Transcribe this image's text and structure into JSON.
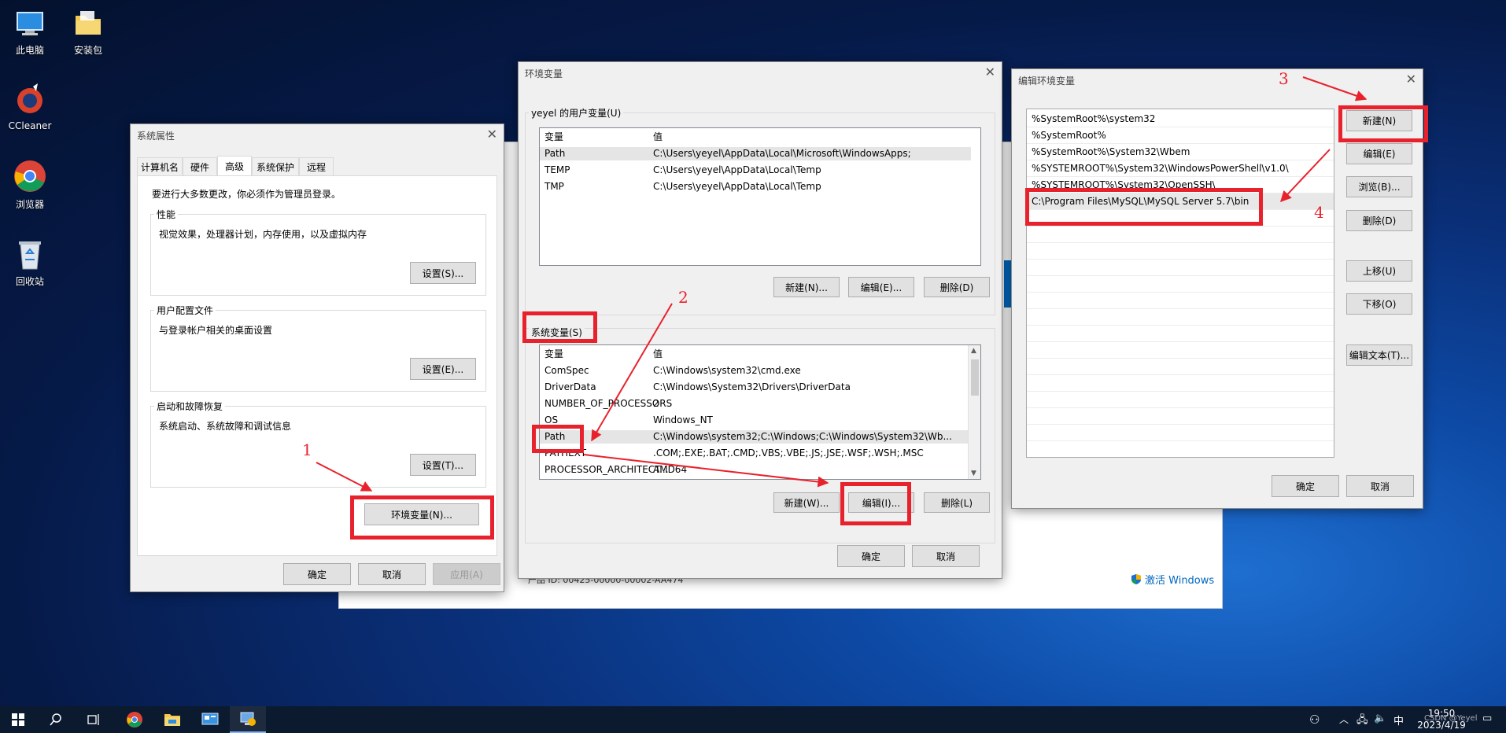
{
  "desktop": {
    "icons": [
      {
        "label": "此电脑"
      },
      {
        "label": "安装包"
      },
      {
        "label": "CCleaner"
      },
      {
        "label": "浏览器"
      },
      {
        "label": "回收站"
      }
    ],
    "activate_windows": "激活 Windows",
    "bg_product_id": "产品 ID: 00425-00000-00002-AA474"
  },
  "sysprops": {
    "title": "系统属性",
    "tabs": [
      "计算机名",
      "硬件",
      "高级",
      "系统保护",
      "远程"
    ],
    "admin_note": "要进行大多数更改，你必须作为管理员登录。",
    "groups": [
      {
        "label": "性能",
        "desc": "视觉效果，处理器计划，内存使用，以及虚拟内存",
        "button": "设置(S)..."
      },
      {
        "label": "用户配置文件",
        "desc": "与登录帐户相关的桌面设置",
        "button": "设置(E)..."
      },
      {
        "label": "启动和故障恢复",
        "desc": "系统启动、系统故障和调试信息",
        "button": "设置(T)..."
      }
    ],
    "env_button": "环境变量(N)...",
    "ok": "确定",
    "cancel": "取消",
    "apply": "应用(A)"
  },
  "envvars": {
    "title": "环境变量",
    "user_group_label": "yeyel 的用户变量(U)",
    "col_var": "变量",
    "col_val": "值",
    "user_vars": [
      {
        "name": "Path",
        "value": "C:\\Users\\yeyel\\AppData\\Local\\Microsoft\\WindowsApps;"
      },
      {
        "name": "TEMP",
        "value": "C:\\Users\\yeyel\\AppData\\Local\\Temp"
      },
      {
        "name": "TMP",
        "value": "C:\\Users\\yeyel\\AppData\\Local\\Temp"
      }
    ],
    "user_buttons": {
      "new": "新建(N)...",
      "edit": "编辑(E)...",
      "delete": "删除(D)"
    },
    "sys_group_label": "系统变量(S)",
    "sys_vars": [
      {
        "name": "ComSpec",
        "value": "C:\\Windows\\system32\\cmd.exe"
      },
      {
        "name": "DriverData",
        "value": "C:\\Windows\\System32\\Drivers\\DriverData"
      },
      {
        "name": "NUMBER_OF_PROCESSORS",
        "value": "2"
      },
      {
        "name": "OS",
        "value": "Windows_NT"
      },
      {
        "name": "Path",
        "value": "C:\\Windows\\system32;C:\\Windows;C:\\Windows\\System32\\Wb..."
      },
      {
        "name": "PATHEXT",
        "value": ".COM;.EXE;.BAT;.CMD;.VBS;.VBE;.JS;.JSE;.WSF;.WSH;.MSC"
      },
      {
        "name": "PROCESSOR_ARCHITECT...",
        "value": "AMD64"
      }
    ],
    "sys_buttons": {
      "new": "新建(W)...",
      "edit": "编辑(I)...",
      "delete": "删除(L)"
    },
    "ok": "确定",
    "cancel": "取消"
  },
  "editenv": {
    "title": "编辑环境变量",
    "entries": [
      "%SystemRoot%\\system32",
      "%SystemRoot%",
      "%SystemRoot%\\System32\\Wbem",
      "%SYSTEMROOT%\\System32\\WindowsPowerShell\\v1.0\\",
      "%SYSTEMROOT%\\System32\\OpenSSH\\",
      "C:\\Program Files\\MySQL\\MySQL Server 5.7\\bin"
    ],
    "buttons": {
      "new": "新建(N)",
      "edit": "编辑(E)",
      "browse": "浏览(B)...",
      "delete": "删除(D)",
      "move_up": "上移(U)",
      "move_down": "下移(O)",
      "edit_text": "编辑文本(T)..."
    },
    "ok": "确定",
    "cancel": "取消"
  },
  "annotations": [
    "1",
    "2",
    "3",
    "4"
  ],
  "taskbar": {
    "time": "19:50",
    "date": "2023/4/19",
    "ime": "中",
    "watermark": "CSDN @Yeyel"
  },
  "colors": {
    "highlight": "#e8222d",
    "accent": "#0067c0"
  }
}
